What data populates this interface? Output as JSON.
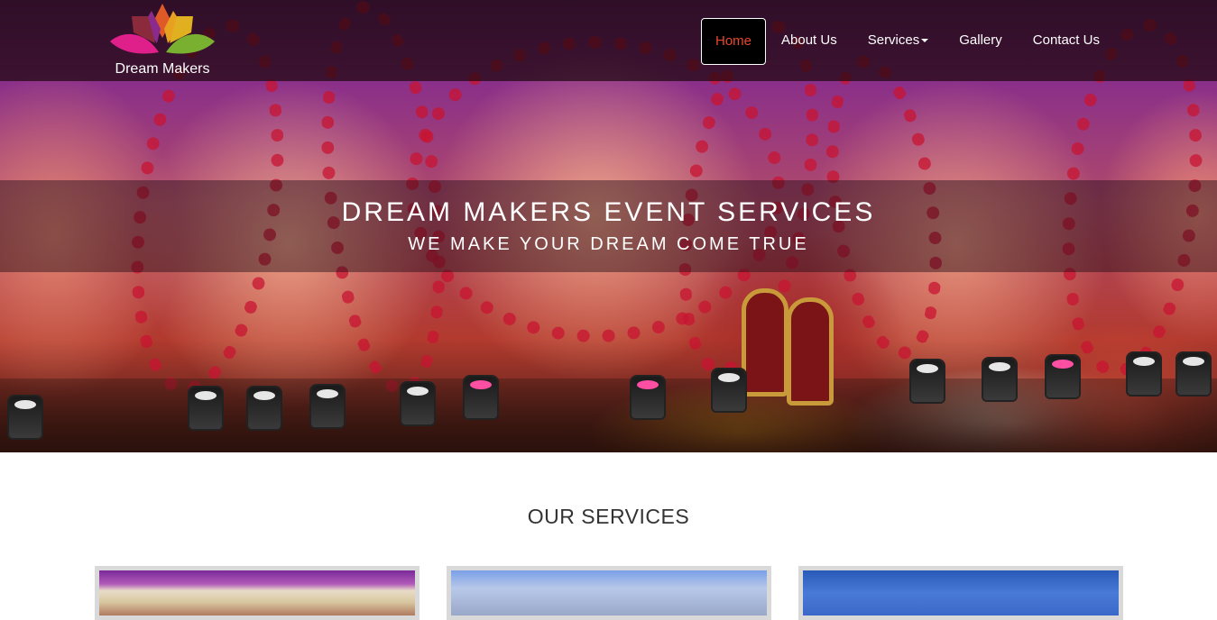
{
  "brand": {
    "name": "Dream Makers",
    "logo_icon": "lotus-logo-icon"
  },
  "nav": {
    "items": [
      {
        "label": "Home",
        "active": true
      },
      {
        "label": "About Us"
      },
      {
        "label": "Services",
        "has_dropdown": true
      },
      {
        "label": "Gallery"
      },
      {
        "label": "Contact Us"
      }
    ]
  },
  "hero": {
    "title": "DREAM MAKERS EVENT SERVICES",
    "subtitle": "WE MAKE YOUR DREAM COME TRUE"
  },
  "services": {
    "heading": "OUR SERVICES"
  },
  "colors": {
    "accent": "#e8462d",
    "navbar_bg": "#1e080e",
    "text_dark": "#333333"
  }
}
